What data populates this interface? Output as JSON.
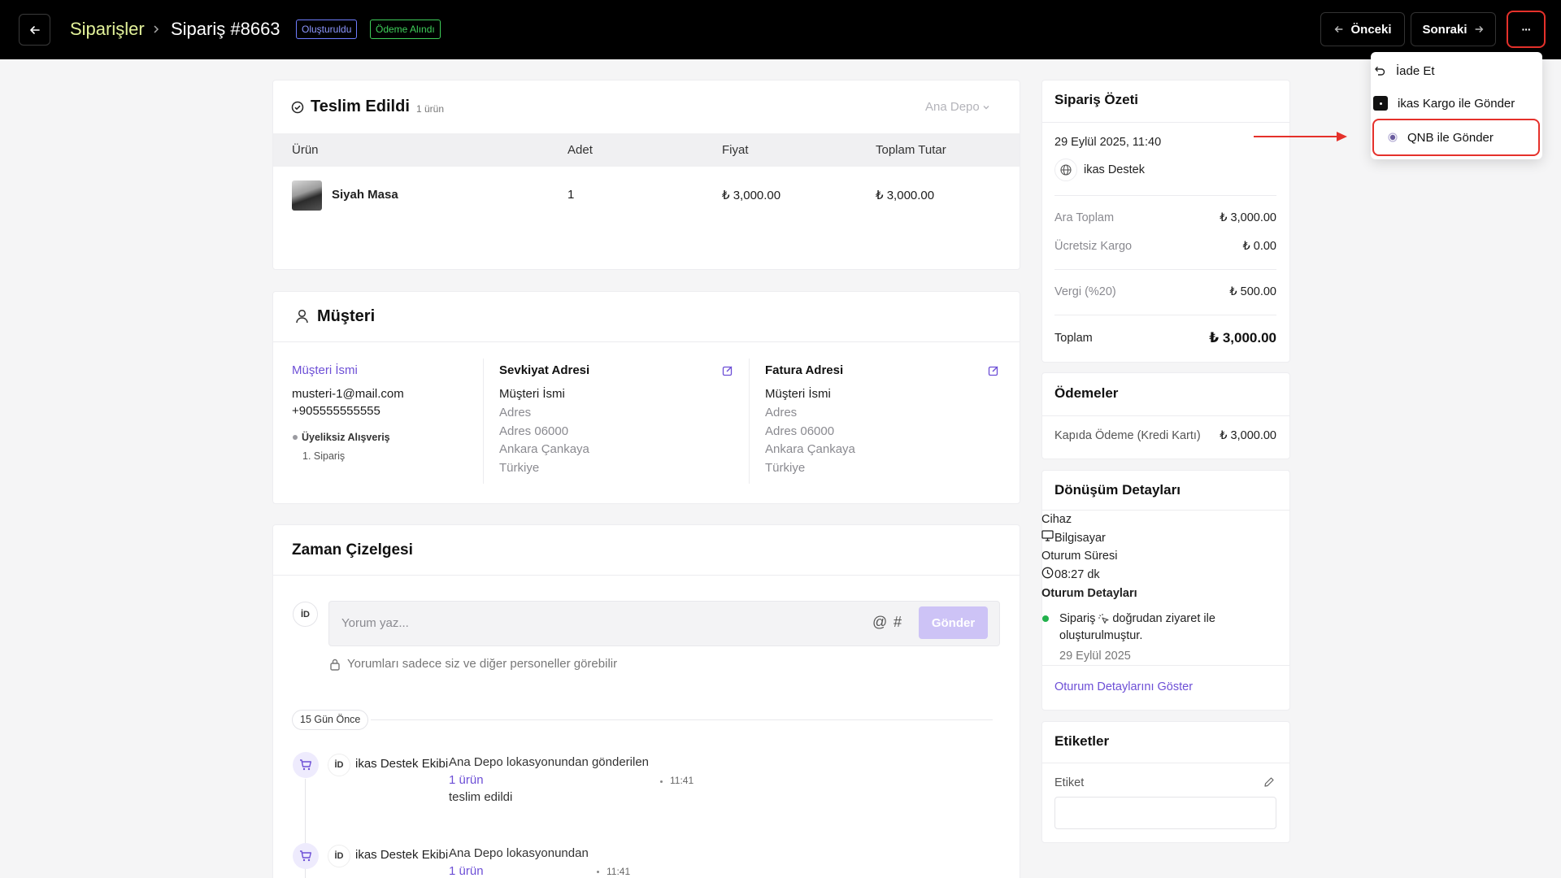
{
  "header": {
    "breadcrumb_root": "Siparişler",
    "order_title": "Sipariş #8663",
    "status_badge": "Oluşturuldu",
    "payment_badge": "Ödeme Alındı",
    "prev_label": "Önceki",
    "next_label": "Sonraki",
    "more_label": "···"
  },
  "menu": {
    "items": [
      {
        "label": "İade Et",
        "icon": "undo-icon"
      },
      {
        "label": "ikas Kargo ile Gönder",
        "icon": "ikas-cargo-icon"
      },
      {
        "label": "QNB ile Gönder",
        "icon": "qnb-icon"
      }
    ]
  },
  "fulfillment": {
    "title": "Teslim Edildi",
    "count": "1 ürün",
    "warehouse": "Ana Depo",
    "columns": [
      "Ürün",
      "Adet",
      "Fiyat",
      "Toplam Tutar"
    ],
    "rows": [
      {
        "product": "Siyah Masa",
        "qty": "1",
        "price": "₺ 3,000.00",
        "total": "₺ 3,000.00"
      }
    ]
  },
  "customer": {
    "title": "Müşteri",
    "name_link": "Müşteri İsmi",
    "email": "musteri-1@mail.com",
    "phone": "+905555555555",
    "guest": "Üyeliksiz Alışveriş",
    "order_count": "1. Sipariş",
    "shipping": {
      "title": "Sevkiyat Adresi",
      "name": "Müşteri İsmi",
      "lines": [
        "Adres",
        "Adres 06000",
        "Ankara Çankaya",
        "Türkiye"
      ]
    },
    "billing": {
      "title": "Fatura Adresi",
      "name": "Müşteri İsmi",
      "lines": [
        "Adres",
        "Adres 06000",
        "Ankara Çankaya",
        "Türkiye"
      ]
    }
  },
  "timeline": {
    "title": "Zaman Çizelgesi",
    "avatar": "İD",
    "comment_placeholder": "Yorum yaz...",
    "at_symbol": "@",
    "hash_symbol": "#",
    "send_label": "Gönder",
    "privacy_note": "Yorumları sadece siz ve diğer personeller görebilir",
    "date_chip": "15 Gün Önce",
    "events": [
      {
        "avatar": "İD",
        "actor": "ikas Destek Ekibi",
        "text1": "Ana Depo lokasyonundan gönderilen",
        "link": "1 ürün",
        "text2": "teslim edildi",
        "time": "11:41"
      },
      {
        "avatar": "İD",
        "actor": "ikas Destek Ekibi",
        "text1": "Ana Depo lokasyonundan",
        "link": "1 ürün",
        "text2": "",
        "time": "11:41"
      }
    ]
  },
  "summary": {
    "title": "Sipariş Özeti",
    "date": "29 Eylül 2025, 11:40",
    "channel": "ikas Destek",
    "rows": [
      {
        "label": "Ara Toplam",
        "value": "₺ 3,000.00"
      },
      {
        "label": "Ücretsiz Kargo",
        "value": "₺ 0.00"
      },
      {
        "label": "Vergi (%20)",
        "value": "₺ 500.00"
      }
    ],
    "total_label": "Toplam",
    "total_value": "₺ 3,000.00"
  },
  "payments": {
    "title": "Ödemeler",
    "method": "Kapıda Ödeme (Kredi Kartı)",
    "amount": "₺ 3,000.00"
  },
  "conversion": {
    "title": "Dönüşüm Detayları",
    "device_label": "Cihaz",
    "device_value": "Bilgisayar",
    "duration_label": "Oturum Süresi",
    "duration_value": "08:27 dk",
    "session_label": "Oturum Detayları",
    "session_text_a": "Sipariş",
    "session_text_b": "doğrudan ziyaret ile",
    "session_text_c": "oluşturulmuştur.",
    "session_date": "29 Eylül 2025",
    "show_link": "Oturum Detaylarını Göster"
  },
  "tags": {
    "title": "Etiketler",
    "label": "Etiket",
    "input_value": ""
  },
  "colors": {
    "header_bg": "#000000",
    "breadcrumb": "#e3f29a",
    "status_badge": "#6f7dff",
    "payment_badge": "#3fcf5a",
    "accent": "#6d4fd6",
    "highlight": "#e5312b"
  }
}
